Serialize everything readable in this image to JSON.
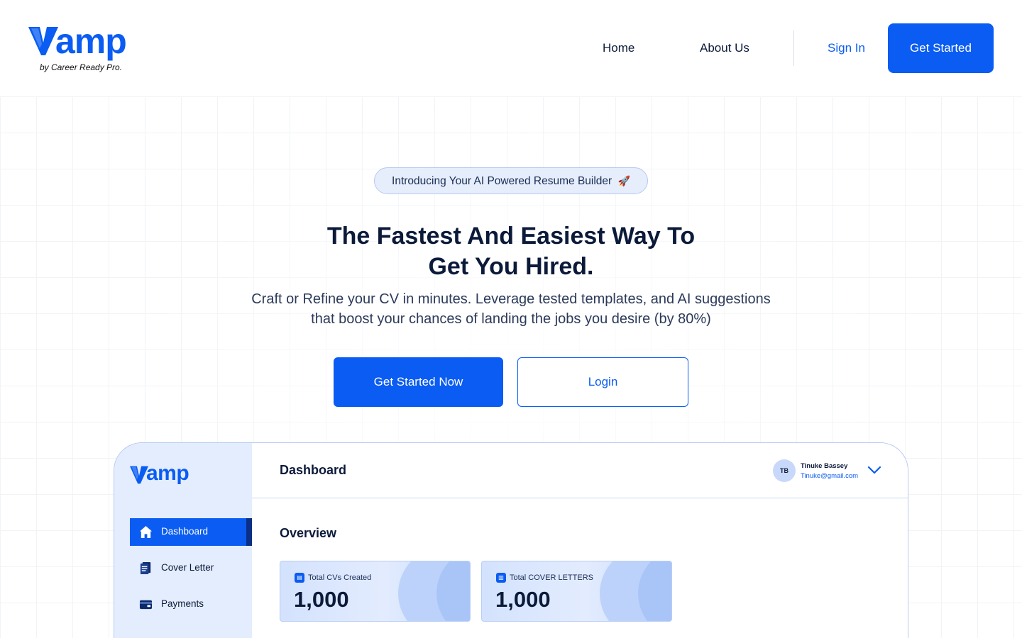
{
  "colors": {
    "brand": "#0a5cf2",
    "text": "#0c1a3a",
    "pill_bg": "#e6eefc",
    "sidebar_bg": "#e4edfd"
  },
  "header": {
    "logo_text": "amp",
    "logo_mark": "V",
    "logo_tagline": "by Career Ready Pro.",
    "nav": {
      "home": "Home",
      "about": "About Us",
      "sign_in": "Sign In",
      "get_started": "Get Started"
    }
  },
  "hero": {
    "pill_text": "Introducing Your AI Powered Resume Builder",
    "pill_icon": "rocket-icon",
    "title_line1": "The Fastest And Easiest Way To",
    "title_line2": "Get You Hired.",
    "subtitle_line1": "Craft or Refine your CV in minutes. Leverage tested templates, and AI suggestions",
    "subtitle_line2": "that boost your chances of landing the jobs you desire (by 80%)",
    "primary_cta": "Get Started Now",
    "secondary_cta": "Login"
  },
  "preview": {
    "logo_text": "amp",
    "sidebar": [
      {
        "label": "Dashboard",
        "icon": "home-icon",
        "active": true
      },
      {
        "label": "Cover Letter",
        "icon": "document-icon",
        "active": false
      },
      {
        "label": "Payments",
        "icon": "wallet-icon",
        "active": false
      }
    ],
    "topbar": {
      "title": "Dashboard",
      "avatar_initials": "TB",
      "user_name": "Tinuke Bassey",
      "user_email": "Tinuke@gmail.com"
    },
    "section_title": "Overview",
    "stats": [
      {
        "label": "Total CVs Created",
        "value": "1,000",
        "icon": "cv-icon"
      },
      {
        "label": "Total COVER LETTERS",
        "value": "1,000",
        "icon": "file-icon"
      }
    ]
  }
}
